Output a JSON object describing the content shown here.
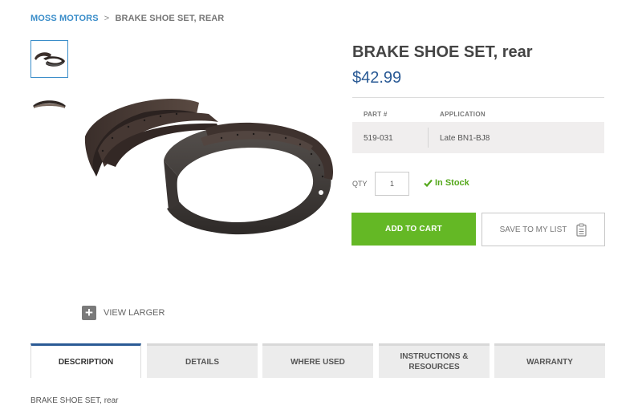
{
  "breadcrumb": {
    "home": "MOSS MOTORS",
    "separator": ">",
    "current": "BRAKE SHOE SET, REAR"
  },
  "thumbnails": [
    {
      "icon": "brake-shoe-set-thumbnail",
      "active": true
    },
    {
      "icon": "brake-shoe-side-thumbnail",
      "active": false
    }
  ],
  "main_image": {
    "icon": "brake-shoe-set-image"
  },
  "view_larger": {
    "icon": "plus-icon",
    "label": "VIEW LARGER"
  },
  "product": {
    "title": "BRAKE SHOE SET, rear",
    "price": "$42.99"
  },
  "specs": {
    "headers": {
      "part": "PART #",
      "application": "APPLICATION"
    },
    "row": {
      "part": "519-031",
      "application": "Late BN1-BJ8"
    }
  },
  "purchase": {
    "qty_label": "QTY",
    "qty_value": "1",
    "stock_icon": "checkmark-icon",
    "stock_text": "In Stock",
    "add_to_cart": "ADD TO CART",
    "save_to_list": "SAVE TO MY LIST",
    "save_icon": "clipboard-icon"
  },
  "tabs": [
    {
      "label": "DESCRIPTION",
      "active": true
    },
    {
      "label": "DETAILS",
      "active": false
    },
    {
      "label": "WHERE USED",
      "active": false
    },
    {
      "label": "INSTRUCTIONS & RESOURCES",
      "active": false
    },
    {
      "label": "WARRANTY",
      "active": false
    }
  ],
  "description": "BRAKE SHOE SET, rear",
  "colors": {
    "link": "#3a8dc9",
    "price": "#2a5a95",
    "add_to_cart": "#64b825",
    "in_stock": "#55a81c"
  }
}
